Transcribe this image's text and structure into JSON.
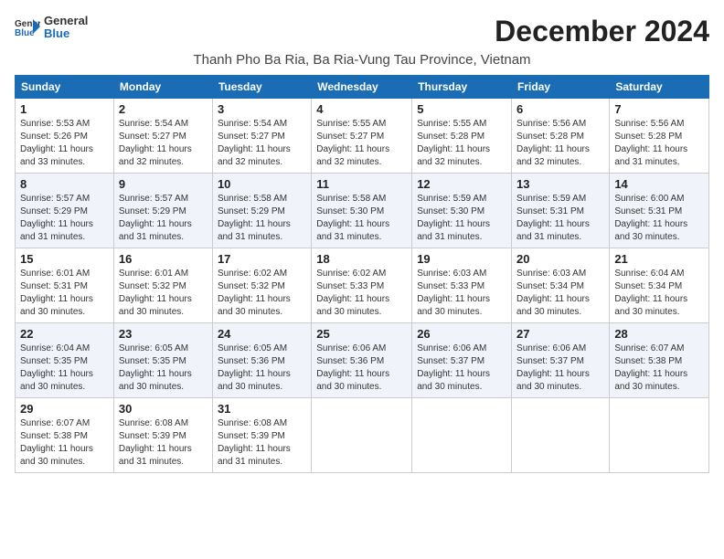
{
  "logo": {
    "line1": "General",
    "line2": "Blue"
  },
  "title": "December 2024",
  "subtitle": "Thanh Pho Ba Ria, Ba Ria-Vung Tau Province, Vietnam",
  "days_of_week": [
    "Sunday",
    "Monday",
    "Tuesday",
    "Wednesday",
    "Thursday",
    "Friday",
    "Saturday"
  ],
  "weeks": [
    [
      {
        "day": "1",
        "sunrise": "5:53 AM",
        "sunset": "5:26 PM",
        "daylight": "11 hours and 33 minutes."
      },
      {
        "day": "2",
        "sunrise": "5:54 AM",
        "sunset": "5:27 PM",
        "daylight": "11 hours and 32 minutes."
      },
      {
        "day": "3",
        "sunrise": "5:54 AM",
        "sunset": "5:27 PM",
        "daylight": "11 hours and 32 minutes."
      },
      {
        "day": "4",
        "sunrise": "5:55 AM",
        "sunset": "5:27 PM",
        "daylight": "11 hours and 32 minutes."
      },
      {
        "day": "5",
        "sunrise": "5:55 AM",
        "sunset": "5:28 PM",
        "daylight": "11 hours and 32 minutes."
      },
      {
        "day": "6",
        "sunrise": "5:56 AM",
        "sunset": "5:28 PM",
        "daylight": "11 hours and 32 minutes."
      },
      {
        "day": "7",
        "sunrise": "5:56 AM",
        "sunset": "5:28 PM",
        "daylight": "11 hours and 31 minutes."
      }
    ],
    [
      {
        "day": "8",
        "sunrise": "5:57 AM",
        "sunset": "5:29 PM",
        "daylight": "11 hours and 31 minutes."
      },
      {
        "day": "9",
        "sunrise": "5:57 AM",
        "sunset": "5:29 PM",
        "daylight": "11 hours and 31 minutes."
      },
      {
        "day": "10",
        "sunrise": "5:58 AM",
        "sunset": "5:29 PM",
        "daylight": "11 hours and 31 minutes."
      },
      {
        "day": "11",
        "sunrise": "5:58 AM",
        "sunset": "5:30 PM",
        "daylight": "11 hours and 31 minutes."
      },
      {
        "day": "12",
        "sunrise": "5:59 AM",
        "sunset": "5:30 PM",
        "daylight": "11 hours and 31 minutes."
      },
      {
        "day": "13",
        "sunrise": "5:59 AM",
        "sunset": "5:31 PM",
        "daylight": "11 hours and 31 minutes."
      },
      {
        "day": "14",
        "sunrise": "6:00 AM",
        "sunset": "5:31 PM",
        "daylight": "11 hours and 30 minutes."
      }
    ],
    [
      {
        "day": "15",
        "sunrise": "6:01 AM",
        "sunset": "5:31 PM",
        "daylight": "11 hours and 30 minutes."
      },
      {
        "day": "16",
        "sunrise": "6:01 AM",
        "sunset": "5:32 PM",
        "daylight": "11 hours and 30 minutes."
      },
      {
        "day": "17",
        "sunrise": "6:02 AM",
        "sunset": "5:32 PM",
        "daylight": "11 hours and 30 minutes."
      },
      {
        "day": "18",
        "sunrise": "6:02 AM",
        "sunset": "5:33 PM",
        "daylight": "11 hours and 30 minutes."
      },
      {
        "day": "19",
        "sunrise": "6:03 AM",
        "sunset": "5:33 PM",
        "daylight": "11 hours and 30 minutes."
      },
      {
        "day": "20",
        "sunrise": "6:03 AM",
        "sunset": "5:34 PM",
        "daylight": "11 hours and 30 minutes."
      },
      {
        "day": "21",
        "sunrise": "6:04 AM",
        "sunset": "5:34 PM",
        "daylight": "11 hours and 30 minutes."
      }
    ],
    [
      {
        "day": "22",
        "sunrise": "6:04 AM",
        "sunset": "5:35 PM",
        "daylight": "11 hours and 30 minutes."
      },
      {
        "day": "23",
        "sunrise": "6:05 AM",
        "sunset": "5:35 PM",
        "daylight": "11 hours and 30 minutes."
      },
      {
        "day": "24",
        "sunrise": "6:05 AM",
        "sunset": "5:36 PM",
        "daylight": "11 hours and 30 minutes."
      },
      {
        "day": "25",
        "sunrise": "6:06 AM",
        "sunset": "5:36 PM",
        "daylight": "11 hours and 30 minutes."
      },
      {
        "day": "26",
        "sunrise": "6:06 AM",
        "sunset": "5:37 PM",
        "daylight": "11 hours and 30 minutes."
      },
      {
        "day": "27",
        "sunrise": "6:06 AM",
        "sunset": "5:37 PM",
        "daylight": "11 hours and 30 minutes."
      },
      {
        "day": "28",
        "sunrise": "6:07 AM",
        "sunset": "5:38 PM",
        "daylight": "11 hours and 30 minutes."
      }
    ],
    [
      {
        "day": "29",
        "sunrise": "6:07 AM",
        "sunset": "5:38 PM",
        "daylight": "11 hours and 30 minutes."
      },
      {
        "day": "30",
        "sunrise": "6:08 AM",
        "sunset": "5:39 PM",
        "daylight": "11 hours and 31 minutes."
      },
      {
        "day": "31",
        "sunrise": "6:08 AM",
        "sunset": "5:39 PM",
        "daylight": "11 hours and 31 minutes."
      },
      null,
      null,
      null,
      null
    ]
  ],
  "labels": {
    "sunrise": "Sunrise:",
    "sunset": "Sunset:",
    "daylight": "Daylight:"
  }
}
